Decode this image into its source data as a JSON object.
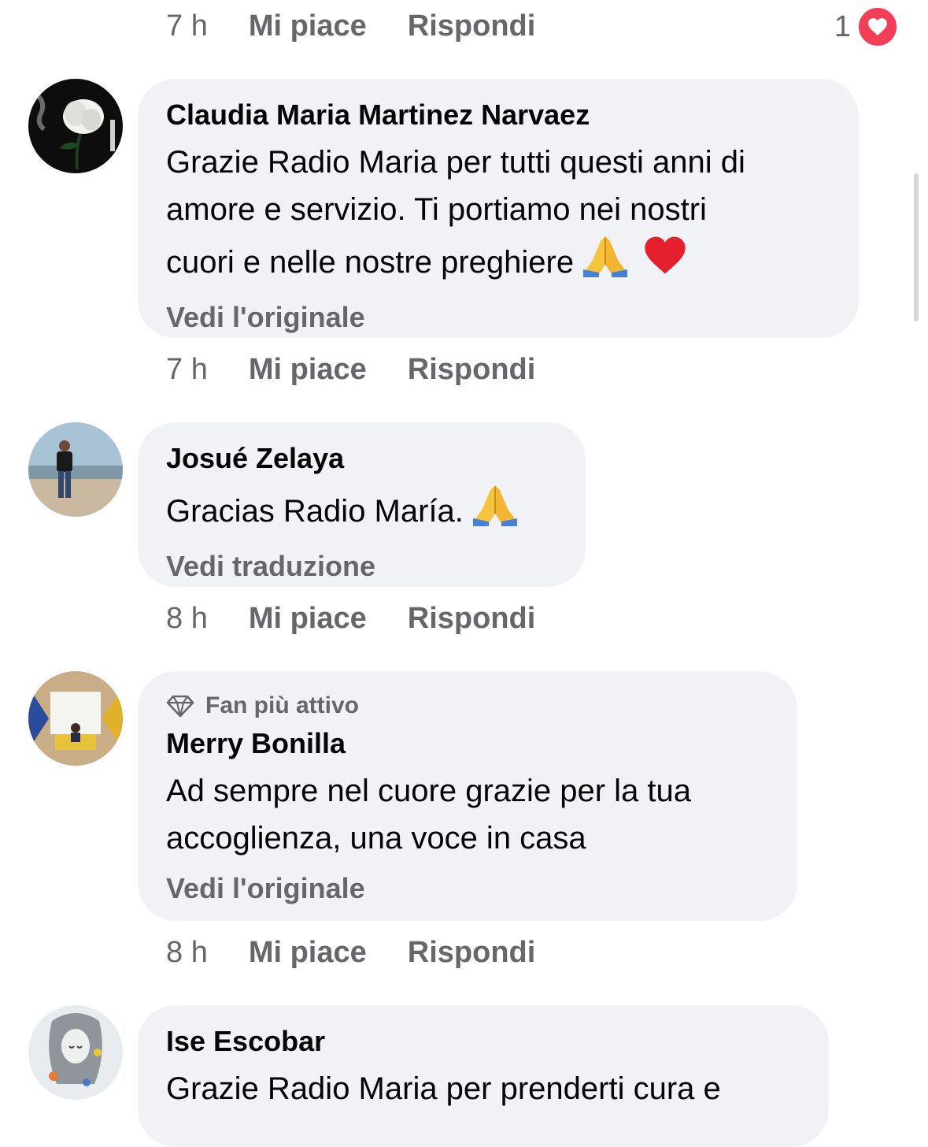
{
  "top_actions": {
    "time": "7 h",
    "like": "Mi piace",
    "reply": "Rispondi",
    "reaction_count": "1"
  },
  "comments": [
    {
      "author": "Claudia Maria Martinez Narvaez",
      "text_lines": [
        "Grazie Radio Maria per tutti questi anni di",
        "amore e servizio. Ti portiamo nei nostri",
        "cuori e nelle nostre preghiere"
      ],
      "link": "Vedi l'originale",
      "time": "7 h",
      "like": "Mi piace",
      "reply": "Rispondi"
    },
    {
      "author": "Josué Zelaya",
      "text_lines": [
        "Gracias Radio María."
      ],
      "link": "Vedi traduzione",
      "time": "8 h",
      "like": "Mi piace",
      "reply": "Rispondi"
    },
    {
      "badge": "Fan più attivo",
      "author": "Merry Bonilla",
      "text_lines": [
        "Ad sempre nel cuore grazie per la tua",
        "accoglienza, una voce in casa"
      ],
      "link": "Vedi l'originale",
      "time": "8 h",
      "like": "Mi piace",
      "reply": "Rispondi"
    },
    {
      "author": "Ise Escobar",
      "text_lines": [
        "Grazie Radio Maria per prenderti cura e"
      ]
    }
  ],
  "colors": {
    "bubble": "#f0f2f5",
    "secondary_text": "#65676b",
    "heart": "#f33e58"
  },
  "icons": [
    "heart-reaction-icon",
    "praying-hands-emoji",
    "red-heart-emoji",
    "diamond-badge-icon"
  ]
}
